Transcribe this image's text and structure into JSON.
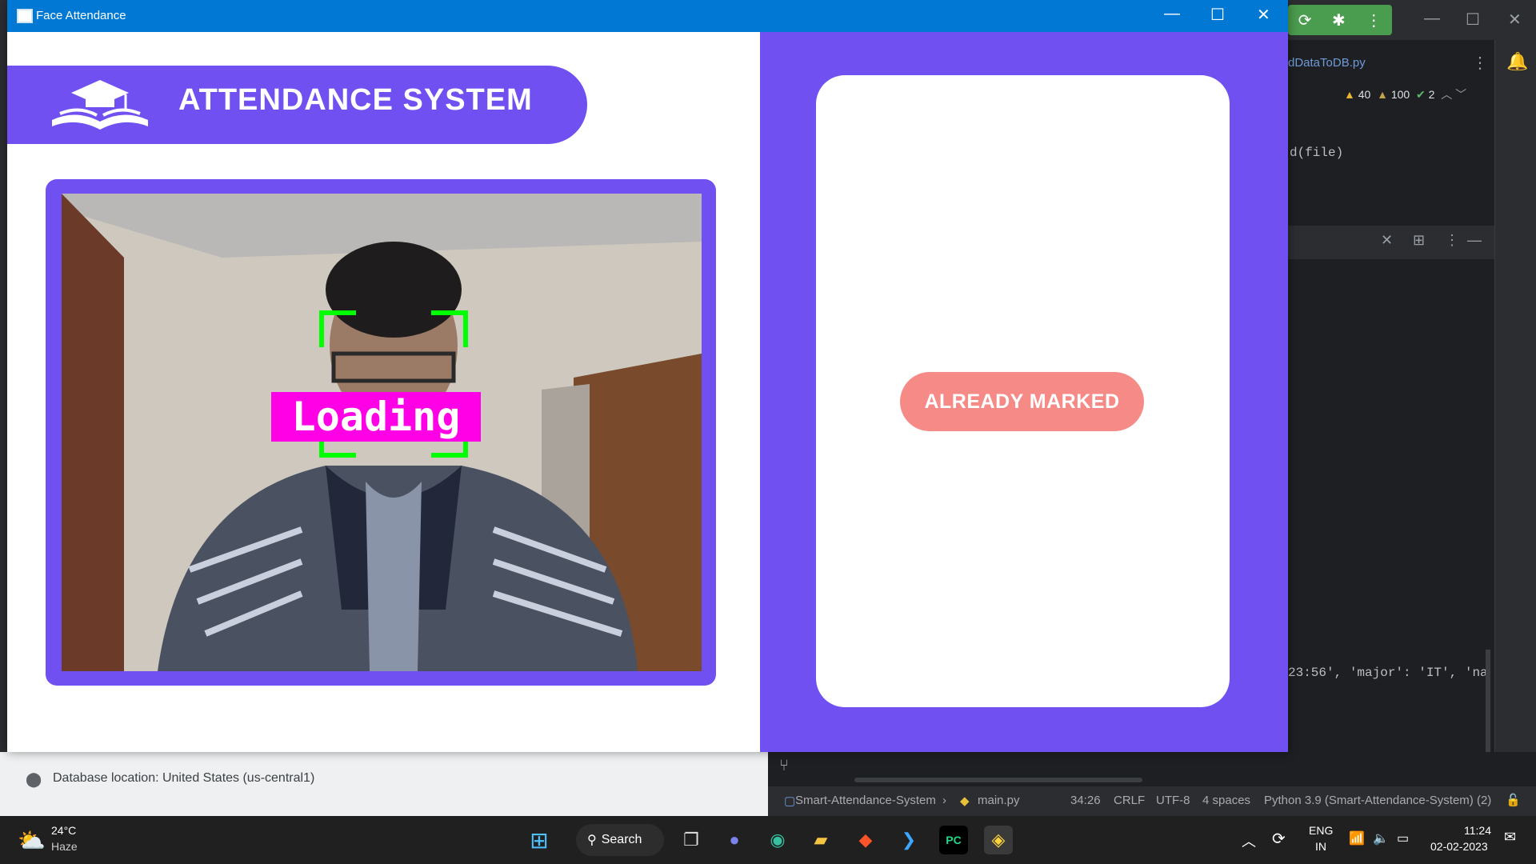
{
  "app": {
    "title": "Face Attendance",
    "header_title": "ATTENDANCE SYSTEM",
    "overlay_text": "Loading",
    "status_button": "ALREADY MARKED"
  },
  "ide": {
    "file_tab": "dDataToDB.py",
    "inspection_warnings": "40",
    "inspection_weak": "100",
    "inspection_ok": "2",
    "code_line_1": "d(file)",
    "code_line_2": "23:56', 'major': 'IT', 'na",
    "status": {
      "project": "Smart-Attendance-System",
      "file": "main.py",
      "position": "34:26",
      "line_ending": "CRLF",
      "encoding": "UTF-8",
      "indent": "4 spaces",
      "interpreter": "Python 3.9 (Smart-Attendance-System) (2)"
    }
  },
  "firebase": {
    "db_location": "Database location: United States (us-central1)"
  },
  "taskbar": {
    "weather_temp": "24°C",
    "weather_desc": "Haze",
    "search_label": "Search",
    "lang_1": "ENG",
    "lang_2": "IN",
    "time": "11:24",
    "date": "02-02-2023"
  },
  "colors": {
    "accent_purple": "#7050f0",
    "status_coral": "#f58a86",
    "titlebar_blue": "#0078d4",
    "face_box_green": "#00ff00",
    "overlay_magenta": "#ff00e6"
  }
}
